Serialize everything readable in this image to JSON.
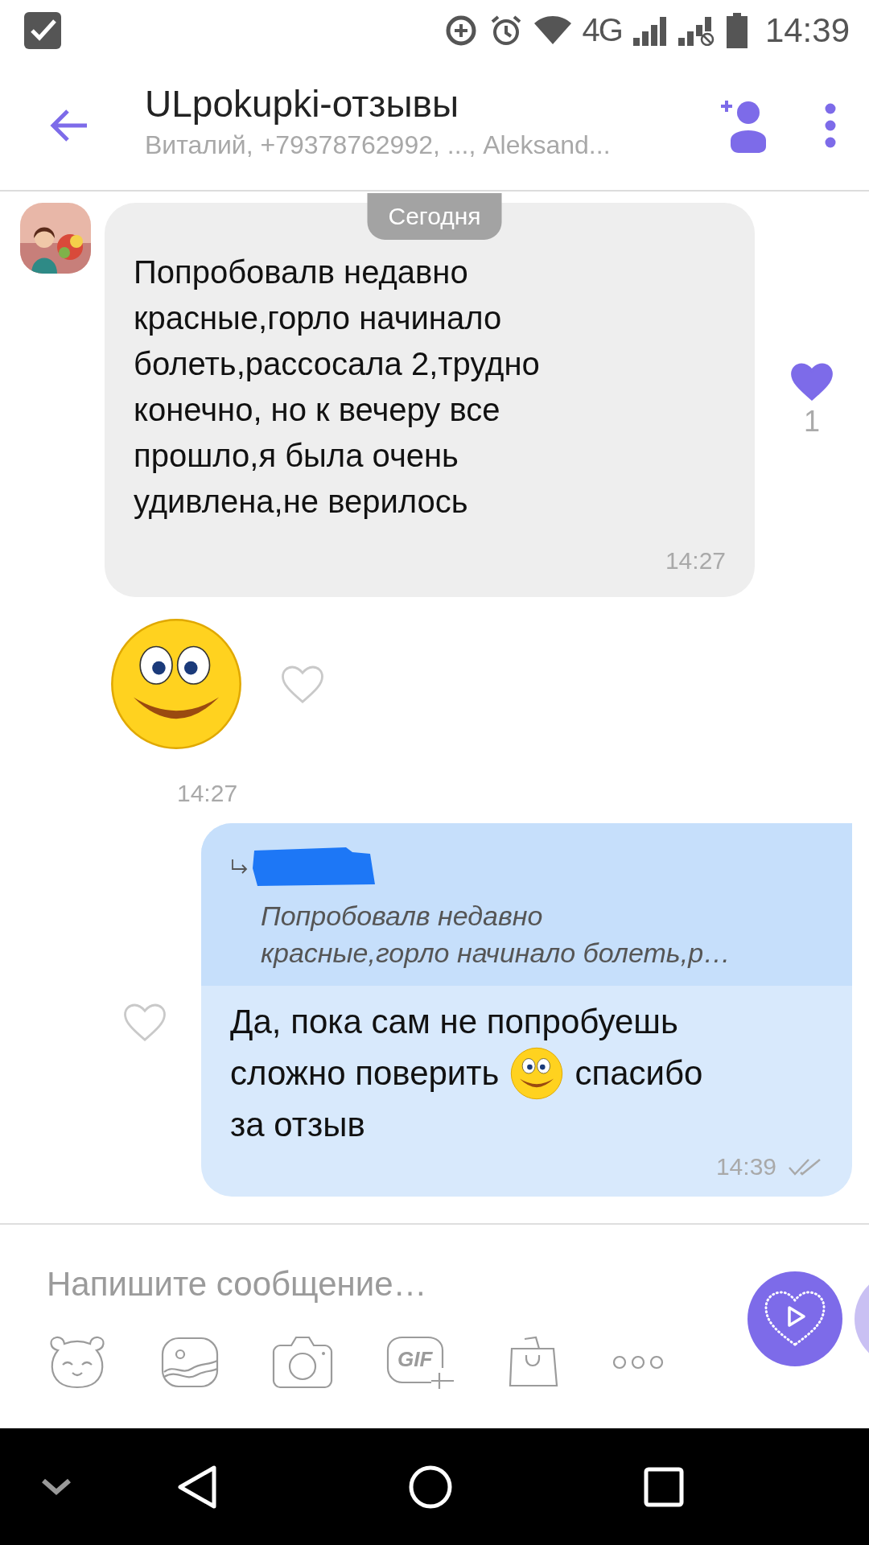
{
  "status_bar": {
    "network": "4G",
    "time": "14:39"
  },
  "header": {
    "title": "ULpokupki-отзывы",
    "subtitle": "Виталий, +79378762992, ..., Aleksand..."
  },
  "date_badge": "Сегодня",
  "messages": [
    {
      "kind": "text",
      "text": "Попробовалв недавно\nкрасные,горло начинало\nболеть,рассосала 2,трудно\nконечно, но к вечеру все\nпрошло,я была очень\nудивлена,не верилось",
      "time": "14:27",
      "liked": true,
      "likes": "1"
    },
    {
      "kind": "sticker",
      "time": "14:27",
      "liked": false
    },
    {
      "kind": "reply",
      "quote": "Попробовалв недавно\nкрасные,горло начинало болеть,р…",
      "lines": [
        [
          {
            "kind": "text",
            "text": "Да, пока сам не попробуешь"
          }
        ],
        [
          {
            "kind": "text",
            "text": "сложно поверить"
          },
          {
            "kind": "emoji"
          },
          {
            "kind": "text",
            "text": "спасибо"
          }
        ],
        [
          {
            "kind": "text",
            "text": "за отзыв"
          }
        ]
      ],
      "time": "14:39",
      "liked": false
    }
  ],
  "composer": {
    "placeholder": "Напишите сообщение…",
    "gif_label": "GIF"
  }
}
